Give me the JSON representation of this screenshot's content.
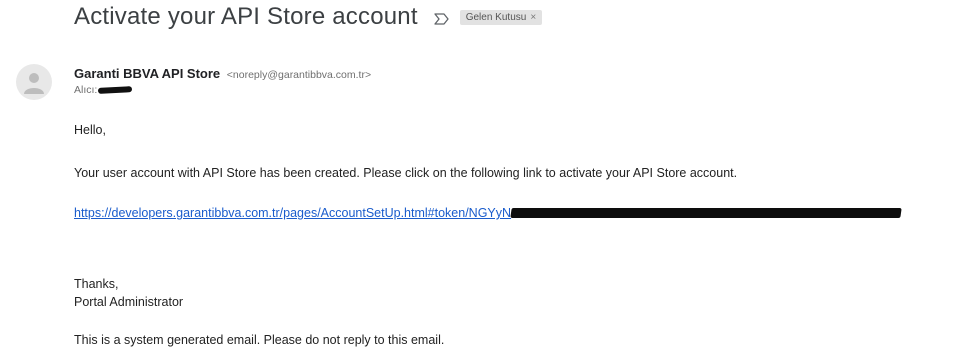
{
  "email": {
    "subject": "Activate your API Store account",
    "important_icon": "importance-marker-icon",
    "label_chip": {
      "text": "Gelen Kutusu",
      "remove": "×"
    },
    "avatar_icon": "person-avatar-icon",
    "sender": {
      "name": "Garanti BBVA API Store",
      "email": "<noreply@garantibbva.com.tr>"
    },
    "recipient_prefix": "Alıcı:",
    "body": {
      "greeting": "Hello,",
      "paragraph": "Your user account with API Store has been created. Please click on the following link to activate your API Store account.",
      "link_text": "https://developers.garantibbva.com.tr/pages/AccountSetUp.html#token/NGYyN",
      "thanks": "Thanks,",
      "signature": "Portal Administrator",
      "footer": "This is a system generated email. Please do not reply to this email."
    }
  }
}
